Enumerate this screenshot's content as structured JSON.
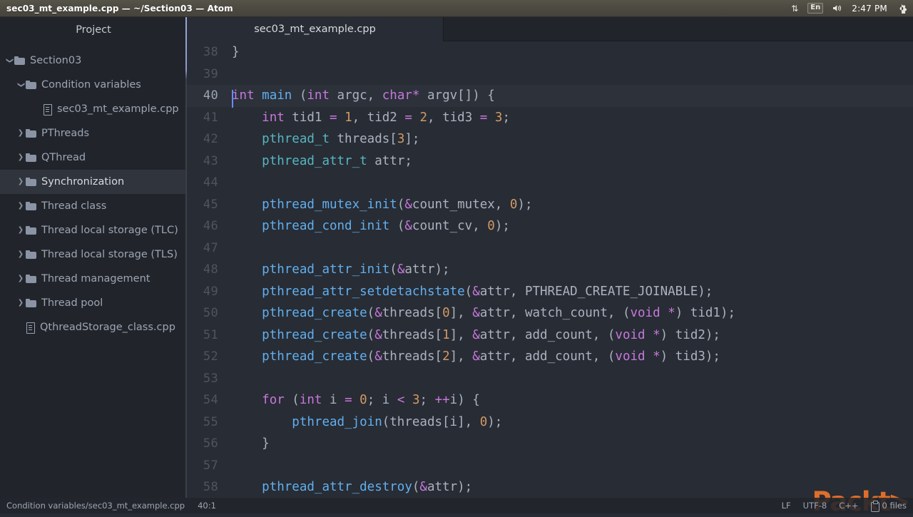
{
  "titlebar": {
    "title": "sec03_mt_example.cpp — ~/Section03 — Atom",
    "tray": {
      "network_icon": "up-down-arrows-icon",
      "network_glyph": "⇅",
      "language": "En",
      "volume_icon": "volume-icon",
      "volume_glyph": "🔊",
      "clock": "2:47 PM",
      "settings_icon": "gear-icon",
      "settings_glyph": "⚙"
    }
  },
  "sidebar": {
    "header": "Project",
    "items": [
      {
        "label": "Section03",
        "depth": 0,
        "kind": "folder",
        "twisty": "open",
        "selected": false
      },
      {
        "label": "Condition variables",
        "depth": 1,
        "kind": "folder",
        "twisty": "open",
        "selected": false
      },
      {
        "label": "sec03_mt_example.cpp",
        "depth": 2,
        "kind": "file",
        "twisty": "none",
        "selected": false
      },
      {
        "label": "PThreads",
        "depth": 1,
        "kind": "folder",
        "twisty": "closed",
        "selected": false
      },
      {
        "label": "QThread",
        "depth": 1,
        "kind": "folder",
        "twisty": "closed",
        "selected": false
      },
      {
        "label": "Synchronization",
        "depth": 1,
        "kind": "folder",
        "twisty": "closed",
        "selected": true
      },
      {
        "label": "Thread class",
        "depth": 1,
        "kind": "folder",
        "twisty": "closed",
        "selected": false
      },
      {
        "label": "Thread local storage (TLC)",
        "depth": 1,
        "kind": "folder",
        "twisty": "closed",
        "selected": false
      },
      {
        "label": "Thread local storage (TLS)",
        "depth": 1,
        "kind": "folder",
        "twisty": "closed",
        "selected": false
      },
      {
        "label": "Thread management",
        "depth": 1,
        "kind": "folder",
        "twisty": "closed",
        "selected": false
      },
      {
        "label": "Thread pool",
        "depth": 1,
        "kind": "folder",
        "twisty": "closed",
        "selected": false
      },
      {
        "label": "QthreadStorage_class.cpp",
        "depth": 1,
        "kind": "file",
        "twisty": "none",
        "selected": false
      }
    ]
  },
  "editor": {
    "tab_label": "sec03_mt_example.cpp",
    "first_line_number": 38,
    "cursor_line": 40,
    "lines": [
      {
        "n": 38,
        "tokens": [
          {
            "t": "}",
            "c": "pl"
          }
        ]
      },
      {
        "n": 39,
        "tokens": []
      },
      {
        "n": 40,
        "caret": true,
        "tokens": [
          {
            "t": "int",
            "c": "kw"
          },
          {
            "t": " ",
            "c": "pl"
          },
          {
            "t": "main",
            "c": "fn"
          },
          {
            "t": " (",
            "c": "pl"
          },
          {
            "t": "int",
            "c": "kw"
          },
          {
            "t": " argc, ",
            "c": "pl"
          },
          {
            "t": "char",
            "c": "kw"
          },
          {
            "t": "*",
            "c": "op"
          },
          {
            "t": " argv[]) {",
            "c": "pl"
          }
        ]
      },
      {
        "n": 41,
        "tokens": [
          {
            "t": "    ",
            "c": "pl"
          },
          {
            "t": "int",
            "c": "kw"
          },
          {
            "t": " tid1 ",
            "c": "pl"
          },
          {
            "t": "=",
            "c": "op"
          },
          {
            "t": " ",
            "c": "pl"
          },
          {
            "t": "1",
            "c": "num"
          },
          {
            "t": ", tid2 ",
            "c": "pl"
          },
          {
            "t": "=",
            "c": "op"
          },
          {
            "t": " ",
            "c": "pl"
          },
          {
            "t": "2",
            "c": "num"
          },
          {
            "t": ", tid3 ",
            "c": "pl"
          },
          {
            "t": "=",
            "c": "op"
          },
          {
            "t": " ",
            "c": "pl"
          },
          {
            "t": "3",
            "c": "num"
          },
          {
            "t": ";",
            "c": "pl"
          }
        ]
      },
      {
        "n": 42,
        "tokens": [
          {
            "t": "    ",
            "c": "pl"
          },
          {
            "t": "pthread_t",
            "c": "type"
          },
          {
            "t": " threads[",
            "c": "pl"
          },
          {
            "t": "3",
            "c": "num"
          },
          {
            "t": "];",
            "c": "pl"
          }
        ]
      },
      {
        "n": 43,
        "tokens": [
          {
            "t": "    ",
            "c": "pl"
          },
          {
            "t": "pthread_attr_t",
            "c": "type"
          },
          {
            "t": " attr;",
            "c": "pl"
          }
        ]
      },
      {
        "n": 44,
        "tokens": []
      },
      {
        "n": 45,
        "tokens": [
          {
            "t": "    ",
            "c": "pl"
          },
          {
            "t": "pthread_mutex_init",
            "c": "fn"
          },
          {
            "t": "(",
            "c": "pl"
          },
          {
            "t": "&",
            "c": "op"
          },
          {
            "t": "count_mutex, ",
            "c": "pl"
          },
          {
            "t": "0",
            "c": "num"
          },
          {
            "t": ");",
            "c": "pl"
          }
        ]
      },
      {
        "n": 46,
        "tokens": [
          {
            "t": "    ",
            "c": "pl"
          },
          {
            "t": "pthread_cond_init",
            "c": "fn"
          },
          {
            "t": " (",
            "c": "pl"
          },
          {
            "t": "&",
            "c": "op"
          },
          {
            "t": "count_cv, ",
            "c": "pl"
          },
          {
            "t": "0",
            "c": "num"
          },
          {
            "t": ");",
            "c": "pl"
          }
        ]
      },
      {
        "n": 47,
        "tokens": []
      },
      {
        "n": 48,
        "tokens": [
          {
            "t": "    ",
            "c": "pl"
          },
          {
            "t": "pthread_attr_init",
            "c": "fn"
          },
          {
            "t": "(",
            "c": "pl"
          },
          {
            "t": "&",
            "c": "op"
          },
          {
            "t": "attr);",
            "c": "pl"
          }
        ]
      },
      {
        "n": 49,
        "tokens": [
          {
            "t": "    ",
            "c": "pl"
          },
          {
            "t": "pthread_attr_setdetachstate",
            "c": "fn"
          },
          {
            "t": "(",
            "c": "pl"
          },
          {
            "t": "&",
            "c": "op"
          },
          {
            "t": "attr, PTHREAD_CREATE_JOINABLE);",
            "c": "pl"
          }
        ]
      },
      {
        "n": 50,
        "tokens": [
          {
            "t": "    ",
            "c": "pl"
          },
          {
            "t": "pthread_create",
            "c": "fn"
          },
          {
            "t": "(",
            "c": "pl"
          },
          {
            "t": "&",
            "c": "op"
          },
          {
            "t": "threads[",
            "c": "pl"
          },
          {
            "t": "0",
            "c": "num"
          },
          {
            "t": "], ",
            "c": "pl"
          },
          {
            "t": "&",
            "c": "op"
          },
          {
            "t": "attr, watch_count, (",
            "c": "pl"
          },
          {
            "t": "void",
            "c": "kw"
          },
          {
            "t": " ",
            "c": "pl"
          },
          {
            "t": "*",
            "c": "op"
          },
          {
            "t": ") tid1);",
            "c": "pl"
          }
        ]
      },
      {
        "n": 51,
        "tokens": [
          {
            "t": "    ",
            "c": "pl"
          },
          {
            "t": "pthread_create",
            "c": "fn"
          },
          {
            "t": "(",
            "c": "pl"
          },
          {
            "t": "&",
            "c": "op"
          },
          {
            "t": "threads[",
            "c": "pl"
          },
          {
            "t": "1",
            "c": "num"
          },
          {
            "t": "], ",
            "c": "pl"
          },
          {
            "t": "&",
            "c": "op"
          },
          {
            "t": "attr, add_count, (",
            "c": "pl"
          },
          {
            "t": "void",
            "c": "kw"
          },
          {
            "t": " ",
            "c": "pl"
          },
          {
            "t": "*",
            "c": "op"
          },
          {
            "t": ") tid2);",
            "c": "pl"
          }
        ]
      },
      {
        "n": 52,
        "tokens": [
          {
            "t": "    ",
            "c": "pl"
          },
          {
            "t": "pthread_create",
            "c": "fn"
          },
          {
            "t": "(",
            "c": "pl"
          },
          {
            "t": "&",
            "c": "op"
          },
          {
            "t": "threads[",
            "c": "pl"
          },
          {
            "t": "2",
            "c": "num"
          },
          {
            "t": "], ",
            "c": "pl"
          },
          {
            "t": "&",
            "c": "op"
          },
          {
            "t": "attr, add_count, (",
            "c": "pl"
          },
          {
            "t": "void",
            "c": "kw"
          },
          {
            "t": " ",
            "c": "pl"
          },
          {
            "t": "*",
            "c": "op"
          },
          {
            "t": ") tid3);",
            "c": "pl"
          }
        ]
      },
      {
        "n": 53,
        "tokens": []
      },
      {
        "n": 54,
        "tokens": [
          {
            "t": "    ",
            "c": "pl"
          },
          {
            "t": "for",
            "c": "kw"
          },
          {
            "t": " (",
            "c": "pl"
          },
          {
            "t": "int",
            "c": "kw"
          },
          {
            "t": " i ",
            "c": "pl"
          },
          {
            "t": "=",
            "c": "op"
          },
          {
            "t": " ",
            "c": "pl"
          },
          {
            "t": "0",
            "c": "num"
          },
          {
            "t": "; i ",
            "c": "pl"
          },
          {
            "t": "<",
            "c": "op"
          },
          {
            "t": " ",
            "c": "pl"
          },
          {
            "t": "3",
            "c": "num"
          },
          {
            "t": "; ",
            "c": "pl"
          },
          {
            "t": "++",
            "c": "op"
          },
          {
            "t": "i) {",
            "c": "pl"
          }
        ]
      },
      {
        "n": 55,
        "tokens": [
          {
            "t": "        ",
            "c": "pl"
          },
          {
            "t": "pthread_join",
            "c": "fn"
          },
          {
            "t": "(threads[i], ",
            "c": "pl"
          },
          {
            "t": "0",
            "c": "num"
          },
          {
            "t": ");",
            "c": "pl"
          }
        ]
      },
      {
        "n": 56,
        "tokens": [
          {
            "t": "    }",
            "c": "pl"
          }
        ]
      },
      {
        "n": 57,
        "tokens": []
      },
      {
        "n": 58,
        "tokens": [
          {
            "t": "    ",
            "c": "pl"
          },
          {
            "t": "pthread_attr_destroy",
            "c": "fn"
          },
          {
            "t": "(",
            "c": "pl"
          },
          {
            "t": "&",
            "c": "op"
          },
          {
            "t": "attr);",
            "c": "pl"
          }
        ]
      }
    ]
  },
  "watermark": {
    "text_main": "Pack",
    "text_chev": "t>"
  },
  "statusbar": {
    "file_path": "Condition variables/sec03_mt_example.cpp",
    "cursor_position": "40:1",
    "line_ending": "LF",
    "encoding": "UTF-8",
    "grammar": "C++",
    "git_icon": "git-changes-icon",
    "git_files": "0 files"
  },
  "colors": {
    "editor_bg": "#282c34",
    "sidebar_bg": "#21252b",
    "accent": "#61afef",
    "keyword": "#c678dd",
    "type": "#56b6c2",
    "number": "#d19a66",
    "plain": "#abb2bf",
    "packt_orange": "#e8722b"
  }
}
